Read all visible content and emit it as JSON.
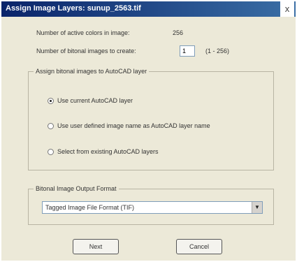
{
  "window": {
    "title": "Assign Image Layers: sunup_2563.tif",
    "close_glyph": "x"
  },
  "info": {
    "active_colors_label": "Number of active colors in image:",
    "active_colors_value": "256",
    "bitonal_count_label": "Number of bitonal images to create:",
    "bitonal_count_value": "1",
    "bitonal_count_range": "(1 - 256)"
  },
  "layer_group": {
    "title": "Assign bitonal images to AutoCAD layer",
    "options": [
      {
        "label": "Use current AutoCAD layer",
        "checked": true
      },
      {
        "label": "Use user defined image name as AutoCAD layer name",
        "checked": false
      },
      {
        "label": "Select from existing AutoCAD layers",
        "checked": false
      }
    ]
  },
  "format_group": {
    "title": "Bitonal Image Output Format",
    "selected": "Tagged Image File Format (TIF)",
    "icon": "chevron-down-icon"
  },
  "buttons": {
    "next": "Next",
    "cancel": "Cancel"
  }
}
